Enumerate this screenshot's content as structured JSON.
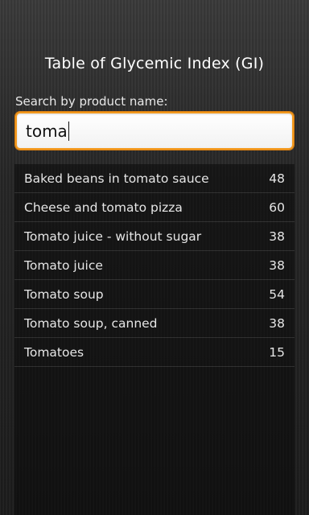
{
  "header": {
    "title": "Table of Glycemic Index (GI)"
  },
  "search": {
    "label": "Search by product name:",
    "value": "toma",
    "focused": true,
    "border_color": "#f39a1f"
  },
  "results": {
    "items": [
      {
        "name": "Baked beans in tomato sauce",
        "gi": "48"
      },
      {
        "name": "Cheese and tomato pizza",
        "gi": "60"
      },
      {
        "name": "Tomato juice - without sugar",
        "gi": "38"
      },
      {
        "name": "Tomato juice",
        "gi": "38"
      },
      {
        "name": "Tomato soup",
        "gi": "54"
      },
      {
        "name": "Tomato soup, canned",
        "gi": "38"
      },
      {
        "name": "Tomatoes",
        "gi": "15"
      }
    ]
  }
}
